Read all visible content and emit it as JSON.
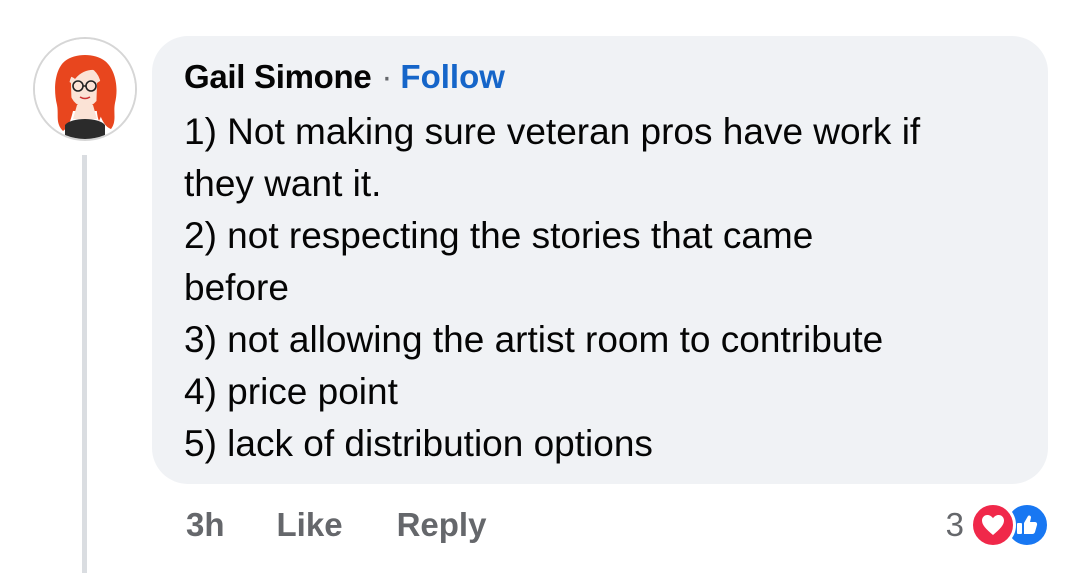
{
  "comment": {
    "author": "Gail Simone",
    "separator": "·",
    "follow_label": "Follow",
    "lines": [
      "1) Not making sure veteran pros have work if",
      "they want it.",
      "2) not respecting the stories that came",
      "before",
      "3) not allowing the artist room to contribute",
      "4) price point",
      "5) lack of distribution options"
    ],
    "timestamp": "3h",
    "like_label": "Like",
    "reply_label": "Reply",
    "reaction_count": "3",
    "reactions": [
      "love-icon",
      "like-icon"
    ]
  },
  "colors": {
    "bubble": "#f0f2f5",
    "follow": "#1565c9",
    "muted": "#65676b",
    "love": "#f0284a",
    "like": "#1877f2"
  }
}
